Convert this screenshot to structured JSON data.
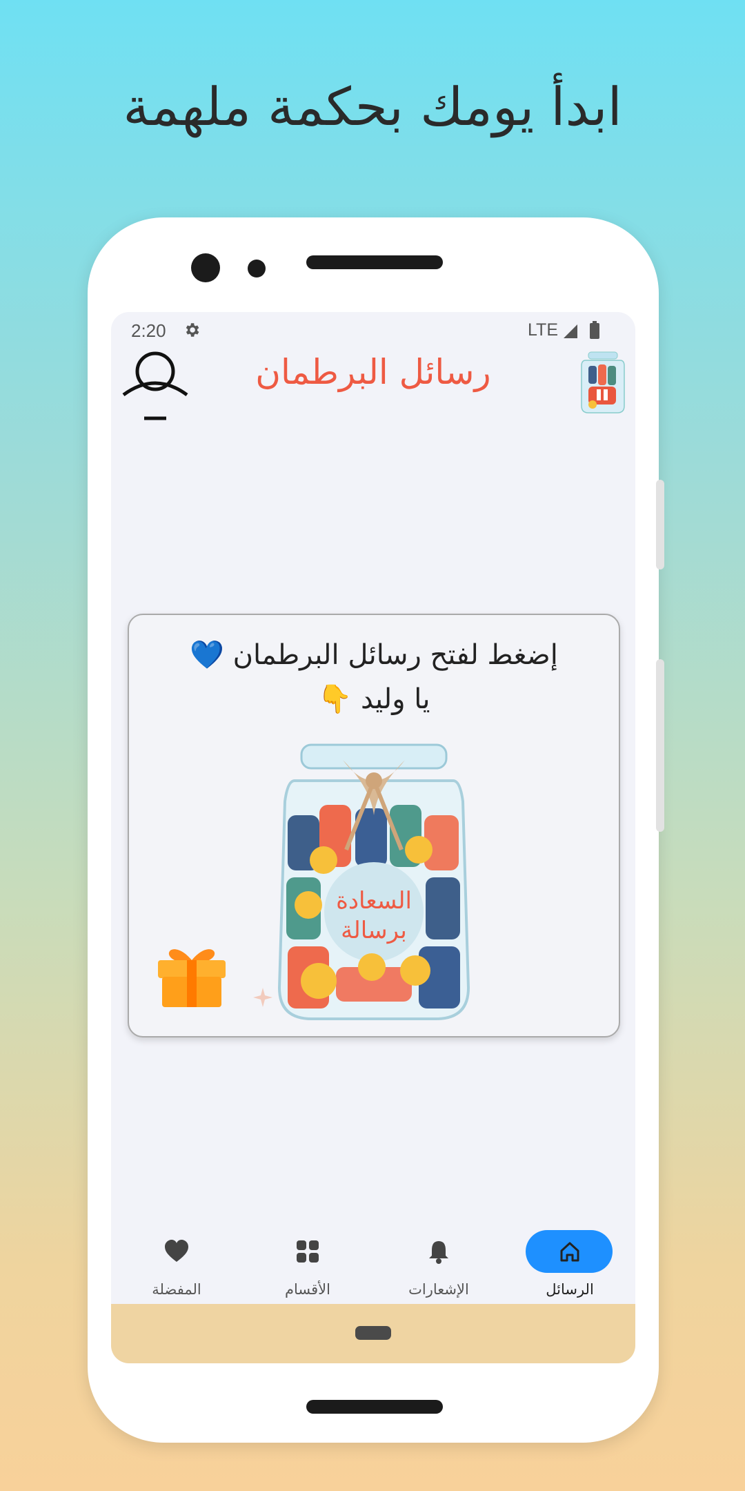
{
  "headline": "ابدأ يومك بحكمة ملهمة",
  "status": {
    "time": "2:20",
    "network": "LTE"
  },
  "app": {
    "title": "رسائل البرطمان"
  },
  "card": {
    "line1": "إضغط لفتح رسائل البرطمان 💙",
    "line2": "يا وليد 👇",
    "jar_label_line1": "السعادة",
    "jar_label_line2": "برسالة"
  },
  "nav": {
    "items": [
      {
        "label": "الرسائل",
        "icon": "home-icon",
        "active": true
      },
      {
        "label": "الإشعارات",
        "icon": "bell-icon",
        "active": false
      },
      {
        "label": "الأقسام",
        "icon": "grid-icon",
        "active": false
      },
      {
        "label": "المفضلة",
        "icon": "heart-icon",
        "active": false
      }
    ]
  },
  "colors": {
    "accent": "#1e90ff",
    "title": "#ee5a43",
    "screen_bg": "#f2f3f9"
  }
}
